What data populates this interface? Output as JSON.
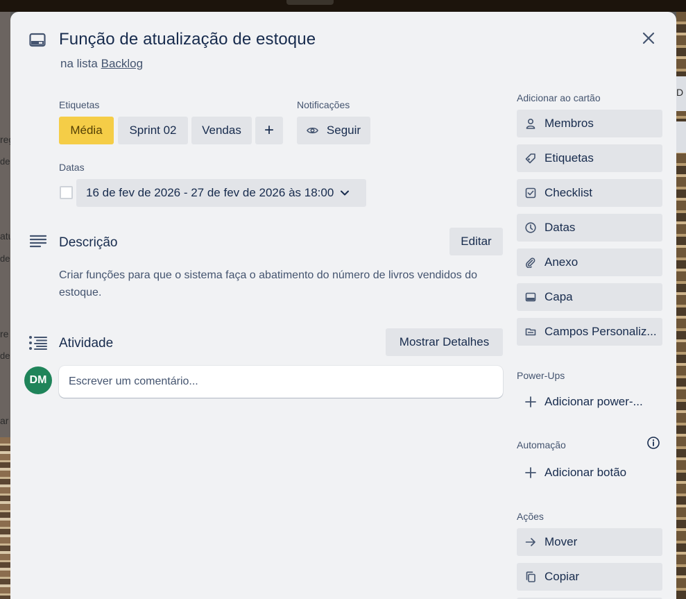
{
  "card": {
    "title": "Função de atualização de estoque",
    "list_prefix": "na lista",
    "list_name": "Backlog"
  },
  "labels_section": {
    "heading": "Etiquetas",
    "items": [
      {
        "text": "Média",
        "color": "#f5cd47"
      },
      {
        "text": "Sprint 02",
        "color": "#e2e4e8"
      },
      {
        "text": "Vendas",
        "color": "#e2e4e8"
      }
    ],
    "add_symbol": "+"
  },
  "notifications": {
    "heading": "Notificações",
    "follow_label": "Seguir"
  },
  "dates": {
    "heading": "Datas",
    "value": "16 de fev de 2026 - 27 de fev de 2026 às 18:00"
  },
  "description": {
    "heading": "Descrição",
    "edit_label": "Editar",
    "text": "Criar funções para que o sistema faça o abatimento do número de livros vendidos do estoque."
  },
  "activity": {
    "heading": "Atividade",
    "details_label": "Mostrar Detalhes",
    "avatar_initials": "DM",
    "avatar_color": "#1f845a",
    "comment_placeholder": "Escrever um comentário..."
  },
  "sidebar": {
    "add_heading": "Adicionar ao cartão",
    "add_items": [
      {
        "label": "Membros",
        "icon": "person-icon"
      },
      {
        "label": "Etiquetas",
        "icon": "tag-icon"
      },
      {
        "label": "Checklist",
        "icon": "checkbox-icon"
      },
      {
        "label": "Datas",
        "icon": "clock-icon"
      },
      {
        "label": "Anexo",
        "icon": "paperclip-icon"
      },
      {
        "label": "Capa",
        "icon": "card-cover-icon"
      },
      {
        "label": "Campos Personaliz...",
        "icon": "custom-fields-icon"
      }
    ],
    "powerups_heading": "Power-Ups",
    "powerups_add": "Adicionar power-...",
    "automation_heading": "Automação",
    "automation_add": "Adicionar botão",
    "actions_heading": "Ações",
    "actions": [
      {
        "label": "Mover",
        "icon": "arrow-right-icon"
      },
      {
        "label": "Copiar",
        "icon": "copy-icon"
      }
    ]
  },
  "background": {
    "fragments": [
      "reg",
      "de",
      "atu",
      "de",
      "re",
      "de",
      "ar",
      "D"
    ]
  }
}
